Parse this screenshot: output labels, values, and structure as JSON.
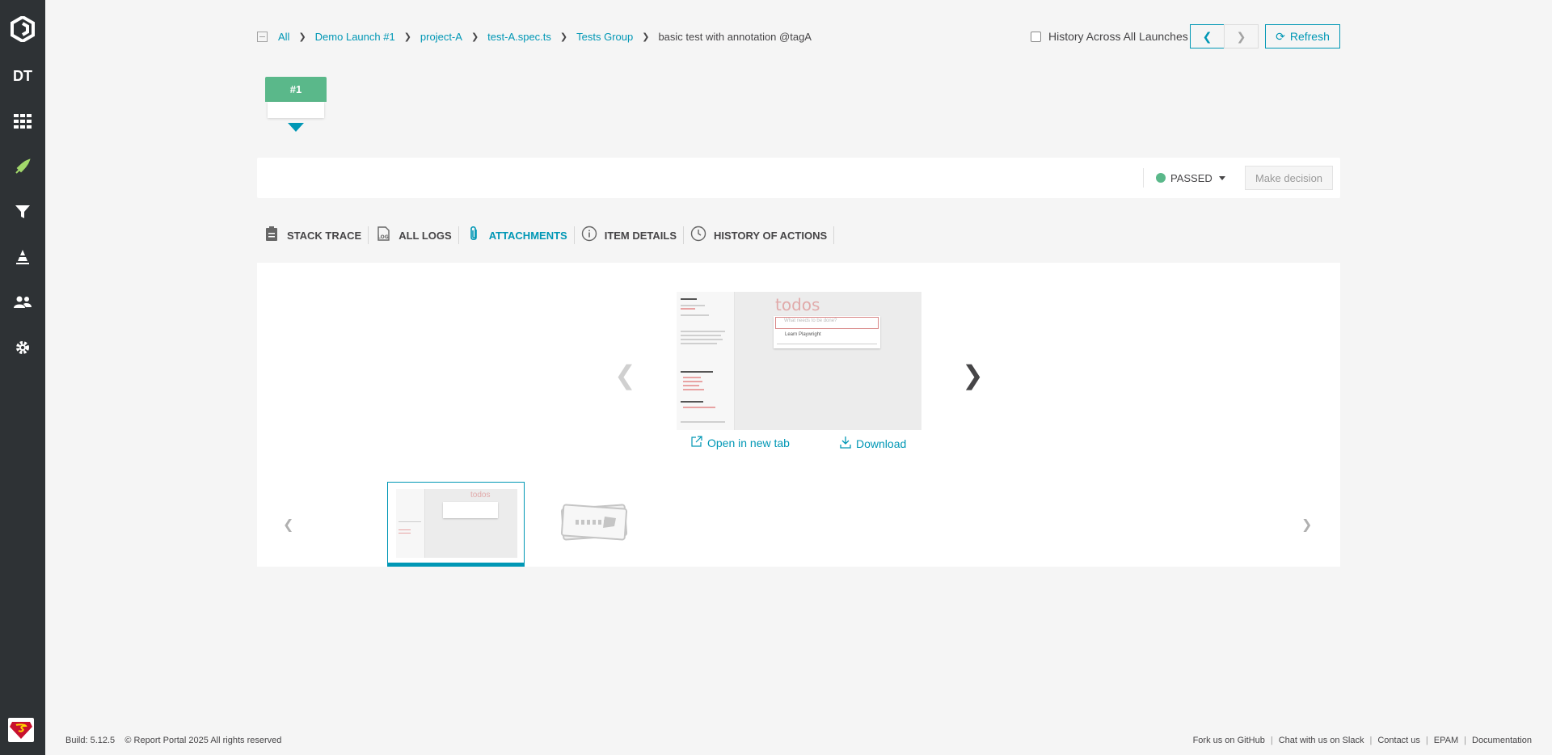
{
  "sidebar": {
    "project_initials": "DT",
    "items": [
      {
        "icon": "dashboard-icon"
      },
      {
        "icon": "launches-icon"
      },
      {
        "icon": "filters-icon"
      },
      {
        "icon": "debug-icon"
      },
      {
        "icon": "members-icon"
      },
      {
        "icon": "settings-icon"
      }
    ]
  },
  "breadcrumb": {
    "items": [
      "All",
      "Demo Launch #1",
      "project-A",
      "test-A.spec.ts",
      "Tests Group"
    ],
    "current": "basic test with annotation @tagA"
  },
  "header": {
    "history_across_label": "History Across All Launches",
    "refresh_label": "Refresh"
  },
  "history": {
    "badge": "#1",
    "status_color": "#5ab88a"
  },
  "status": {
    "value": "PASSED",
    "make_decision_label": "Make decision"
  },
  "tabs": [
    {
      "label": "STACK TRACE",
      "icon": "clipboard-icon"
    },
    {
      "label": "ALL LOGS",
      "icon": "log-icon"
    },
    {
      "label": "ATTACHMENTS",
      "icon": "paperclip-icon",
      "active": true
    },
    {
      "label": "ITEM DETAILS",
      "icon": "info-icon"
    },
    {
      "label": "HISTORY OF ACTIONS",
      "icon": "clock-icon"
    }
  ],
  "attachments": {
    "preview": {
      "app_title": "todos",
      "input_placeholder": "What needs to be done?",
      "todo_item": "Learn Playwright"
    },
    "open_label": "Open in new tab",
    "download_label": "Download"
  },
  "footer": {
    "build": "Build: 5.12.5",
    "copyright": "© Report Portal 2025 All rights reserved",
    "links": [
      "Fork us on GitHub",
      "Chat with us on Slack",
      "Contact us",
      "EPAM",
      "Documentation"
    ]
  },
  "colors": {
    "accent": "#0097b5",
    "passed": "#5ab88a",
    "sidebar": "#2e3235"
  }
}
